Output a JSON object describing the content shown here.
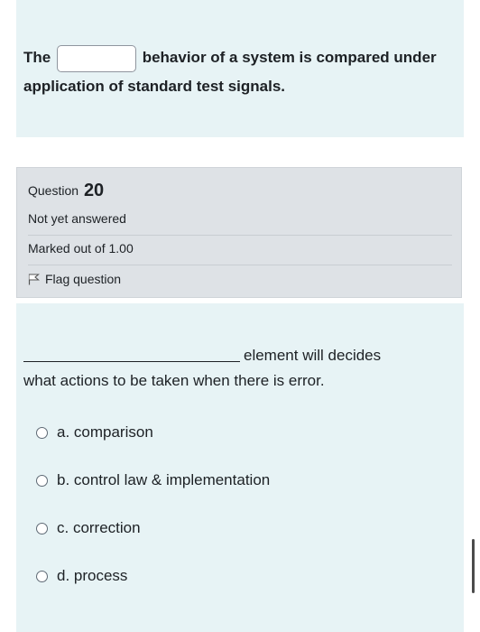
{
  "previous_question": {
    "text_before": "The",
    "text_after": "behavior of a system is compared under application of standard test signals.",
    "input_value": ""
  },
  "info": {
    "question_label": "Question",
    "question_number": "20",
    "status": "Not yet answered",
    "marks": "Marked out of 1.00",
    "flag_label": "Flag question"
  },
  "question": {
    "text_line1": "element will decides",
    "text_line2": "what actions to be taken when there is error."
  },
  "options": [
    {
      "label": "a. comparison"
    },
    {
      "label": "b. control law & implementation"
    },
    {
      "label": "c. correction"
    },
    {
      "label": "d. process"
    }
  ]
}
